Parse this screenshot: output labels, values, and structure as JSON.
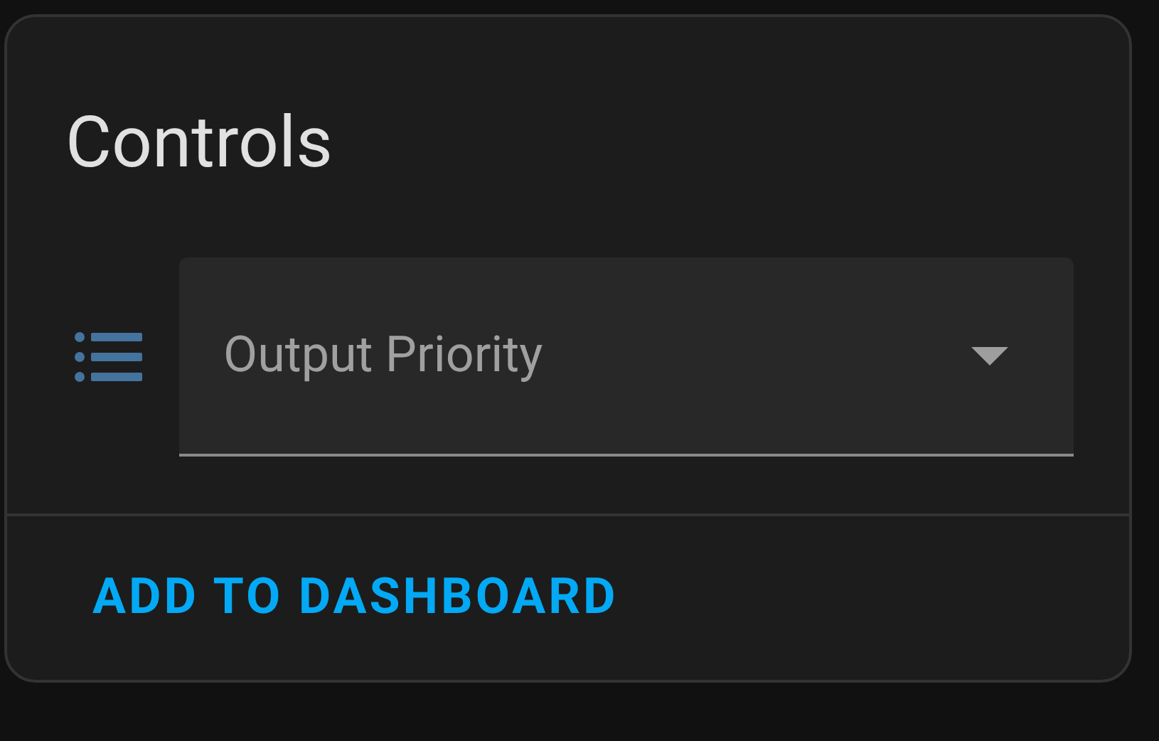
{
  "card": {
    "title": "Controls",
    "entities": [
      {
        "kind": "select",
        "label": "Output Priority"
      }
    ],
    "actions": [
      "ADD TO DASHBOARD"
    ]
  }
}
